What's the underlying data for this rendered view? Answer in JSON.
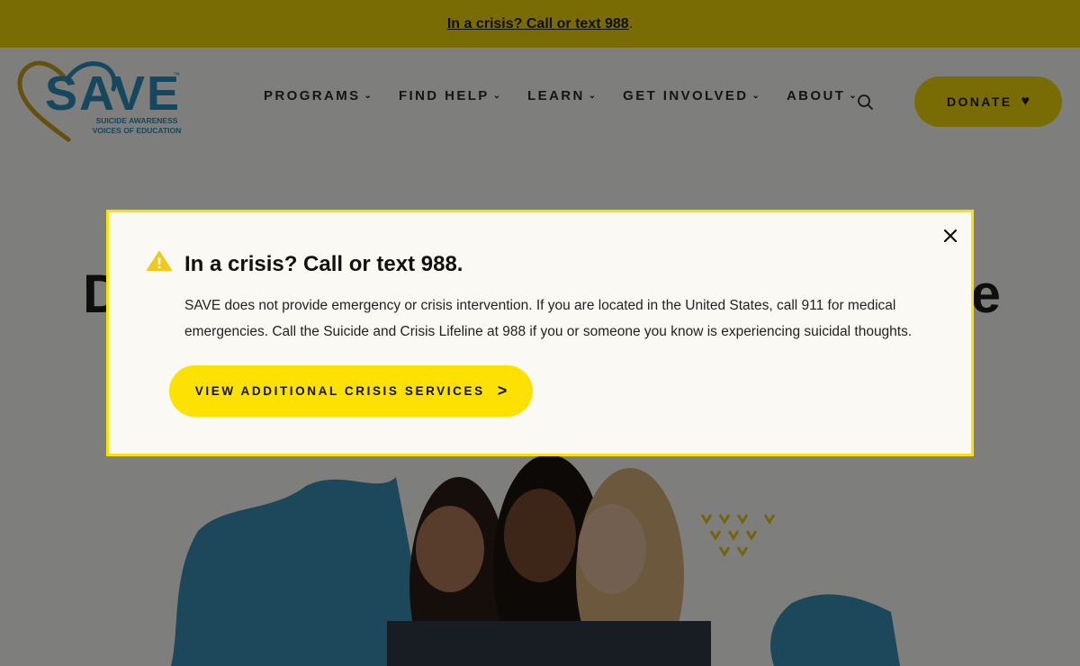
{
  "top_banner": {
    "link_text": "In a crisis? Call or text 988",
    "suffix": "."
  },
  "logo": {
    "word": "SAVE",
    "tm": "™",
    "line1": "SUICIDE AWARENESS",
    "line2": "VOICES OF EDUCATION"
  },
  "nav": {
    "items": [
      {
        "label": "PROGRAMS"
      },
      {
        "label": "FIND HELP"
      },
      {
        "label": "LEARN"
      },
      {
        "label": "GET INVOLVED"
      },
      {
        "label": "ABOUT"
      }
    ],
    "chevron": "⌄",
    "search_icon": "search-icon",
    "donate_label": "DONATE",
    "donate_icon": "heart-icon"
  },
  "hero": {
    "title_start": "D",
    "title_end": "e"
  },
  "modal": {
    "title": "In a crisis? Call or text 988.",
    "body": "SAVE does not provide emergency or crisis intervention. If you are located in the United States, call 911 for medical emergencies. Call the Suicide and Crisis Lifeline at 988 if you or someone you know is experiencing suicidal thoughts.",
    "button_label": "VIEW ADDITIONAL CRISIS SERVICES",
    "button_arrow": ">",
    "close_icon": "close-icon",
    "warning_icon": "warning-icon"
  },
  "colors": {
    "accent_yellow": "#fde100",
    "brand_blue": "#2a8fbd",
    "brand_gold": "#c9a21a"
  }
}
